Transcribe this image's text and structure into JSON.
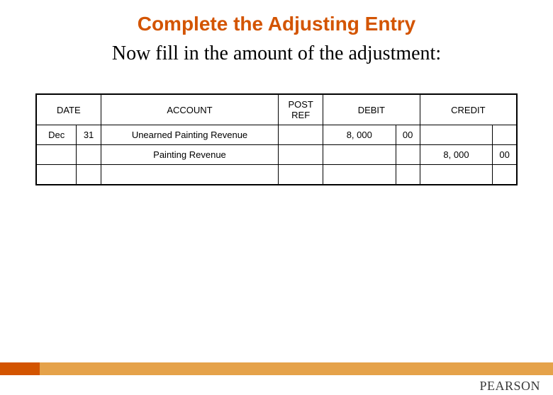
{
  "title": "Complete the Adjusting Entry",
  "subtitle": "Now fill in the amount of the adjustment:",
  "headers": {
    "date": "DATE",
    "account": "ACCOUNT",
    "post_ref": "POST REF",
    "debit": "DEBIT",
    "credit": "CREDIT"
  },
  "rows": [
    {
      "month": "Dec",
      "day": "31",
      "account": "Unearned Painting Revenue",
      "post_ref": "",
      "debit_main": "8, 000",
      "debit_cents": "00",
      "credit_main": "",
      "credit_cents": ""
    },
    {
      "month": "",
      "day": "",
      "account": "Painting Revenue",
      "post_ref": "",
      "debit_main": "",
      "debit_cents": "",
      "credit_main": "8, 000",
      "credit_cents": "00"
    },
    {
      "month": "",
      "day": "",
      "account": "",
      "post_ref": "",
      "debit_main": "",
      "debit_cents": "",
      "credit_main": "",
      "credit_cents": ""
    }
  ],
  "brand": "PEARSON",
  "chart_data": {
    "type": "table",
    "title": "Adjusting Entry Journal",
    "columns": [
      "DATE",
      "ACCOUNT",
      "POST REF",
      "DEBIT",
      "CREDIT"
    ],
    "rows": [
      [
        "Dec 31",
        "Unearned Painting Revenue",
        "",
        "8,000.00",
        ""
      ],
      [
        "",
        "Painting Revenue",
        "",
        "",
        "8,000.00"
      ]
    ]
  }
}
